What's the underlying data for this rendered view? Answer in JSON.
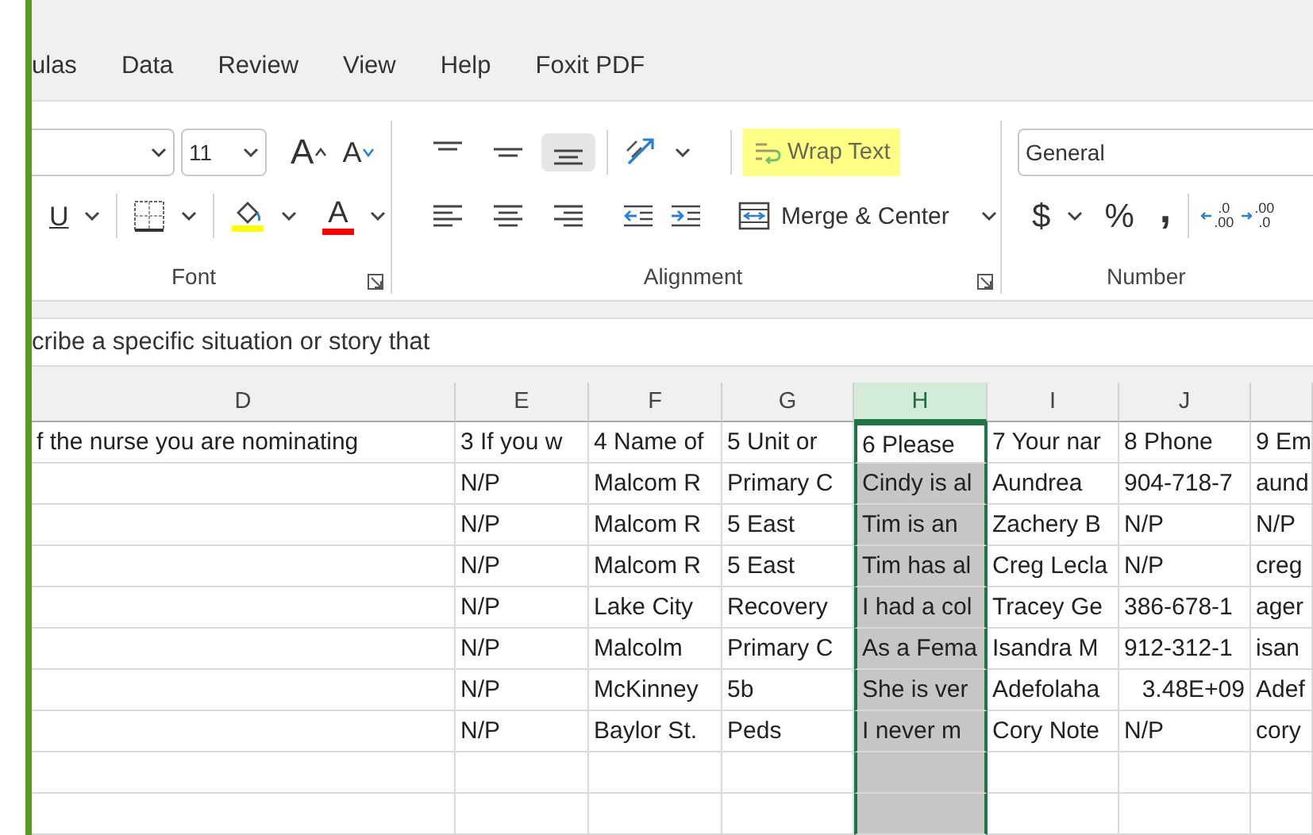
{
  "menu_tabs": [
    "ulas",
    "Data",
    "Review",
    "View",
    "Help",
    "Foxit PDF"
  ],
  "ribbon": {
    "font": {
      "font_size": "11",
      "grow_glyph": "A",
      "shrink_glyph": "A",
      "underline_glyph": "U",
      "font_color_glyph": "A",
      "label": "Font"
    },
    "alignment": {
      "vertical": [
        {
          "kind": "top",
          "selected": false
        },
        {
          "kind": "middle",
          "selected": false
        },
        {
          "kind": "bottom",
          "selected": true
        }
      ],
      "horizontal": [
        {
          "kind": "left"
        },
        {
          "kind": "center"
        },
        {
          "kind": "right"
        }
      ],
      "wrap_text": {
        "label": "Wrap Text",
        "highlighted": true
      },
      "merge": {
        "label": "Merge & Center"
      },
      "label": "Alignment"
    },
    "number": {
      "format": "General",
      "currency": "$",
      "percent": "%",
      "comma": ",",
      "increase_decimal": [
        ".0",
        ".00"
      ],
      "decrease_decimal": [
        ".00",
        ".0"
      ],
      "label": "Number"
    }
  },
  "formula_bar": {
    "text": "cribe a specific situation or story that"
  },
  "columns": [
    {
      "letter": "D",
      "selected": false
    },
    {
      "letter": "E",
      "selected": false
    },
    {
      "letter": "F",
      "selected": false
    },
    {
      "letter": "G",
      "selected": false
    },
    {
      "letter": "H",
      "selected": true
    },
    {
      "letter": "I",
      "selected": false
    },
    {
      "letter": "J",
      "selected": false
    }
  ],
  "rows": [
    {
      "active": true,
      "cells": [
        "f the nurse you are nominating",
        "3 If you w",
        "4 Name of",
        "5 Unit or",
        "6 Please",
        "7 Your nar",
        "8 Phone",
        "9 Em"
      ]
    },
    {
      "active": false,
      "cells": [
        "",
        "N/P",
        "Malcom R",
        "Primary C",
        "Cindy is al",
        "Aundrea",
        "904-718-7",
        "aund"
      ]
    },
    {
      "active": false,
      "cells": [
        "",
        "N/P",
        "Malcom R",
        "5 East",
        "Tim is an",
        "Zachery B",
        "N/P",
        "N/P"
      ]
    },
    {
      "active": false,
      "cells": [
        "",
        "N/P",
        "Malcom R",
        "5 East",
        "Tim has al",
        "Creg Lecla",
        "N/P",
        "creg"
      ]
    },
    {
      "active": false,
      "cells": [
        "",
        "N/P",
        "Lake City",
        "Recovery",
        "I had a col",
        "Tracey Ge",
        "386-678-1",
        "ager"
      ]
    },
    {
      "active": false,
      "cells": [
        "",
        "N/P",
        "Malcolm",
        "Primary C",
        "As a Fema",
        "Isandra M",
        "912-312-1",
        "isan"
      ]
    },
    {
      "active": false,
      "cells": [
        "",
        "N/P",
        "McKinney",
        "5b",
        "She is ver",
        "Adefolaha",
        "3.48E+09",
        "Adef"
      ]
    },
    {
      "active": false,
      "cells": [
        "",
        "N/P",
        "Baylor St.",
        "Peds",
        "I never m",
        "Cory Note",
        "N/P",
        "cory"
      ]
    },
    {
      "active": false,
      "cells": [
        "",
        "",
        "",
        "",
        "",
        "",
        "",
        ""
      ]
    },
    {
      "active": false,
      "cells": [
        "",
        "",
        "",
        "",
        "",
        "",
        "",
        ""
      ]
    }
  ]
}
